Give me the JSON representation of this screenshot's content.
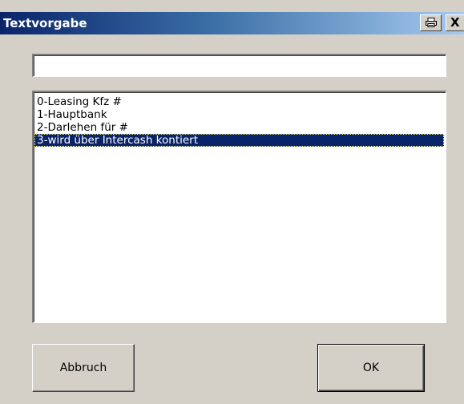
{
  "window": {
    "title": "Textvorgabe",
    "print_icon": "printer-icon",
    "close_label": "X"
  },
  "input": {
    "value": "",
    "placeholder": ""
  },
  "list": {
    "items": [
      "0-Leasing Kfz #",
      "1-Hauptbank",
      "2-Darlehen für #",
      "3-wird über Intercash kontiert"
    ],
    "selected_index": 3
  },
  "buttons": {
    "cancel_label": "Abbruch",
    "ok_label": "OK"
  },
  "colors": {
    "titlebar_start": "#0a246a",
    "titlebar_end": "#a6caf0",
    "selection": "#0a246a",
    "face": "#d4d0c8"
  }
}
